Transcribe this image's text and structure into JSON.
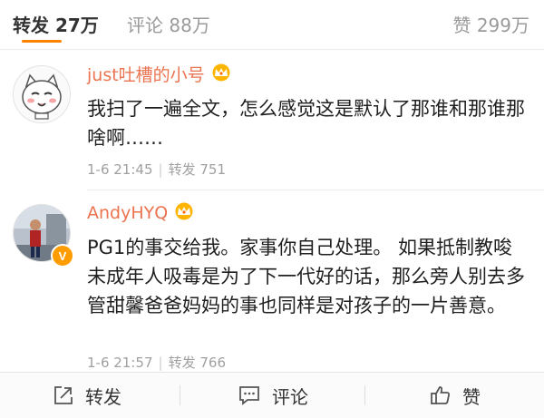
{
  "tabs": {
    "repost": {
      "label": "转发",
      "count": "27万"
    },
    "comment": {
      "label": "评论",
      "count": "88万"
    },
    "like": {
      "label": "赞",
      "count": "299万"
    }
  },
  "comments": [
    {
      "username": "just吐槽的小号",
      "content": "我扫了一遍全文，怎么感觉这是默认了那谁和那谁那啥啊……",
      "time": "1-6 21:45",
      "repost_label": "转发",
      "repost_count": "751"
    },
    {
      "username": "AndyHYQ",
      "content": "PG1的事交给我。家事你自己处理。 如果抵制教唆未成年人吸毒是为了下一代好的话，那么旁人别去多管甜馨爸爸妈妈的事也同样是对孩子的一片善意。",
      "time": "1-6 21:57",
      "repost_label": "转发",
      "repost_count": "766",
      "verified_badge": "V"
    }
  ],
  "actions": {
    "repost": "转发",
    "comment": "评论",
    "like": "赞"
  },
  "colors": {
    "accent": "#ff8200",
    "username": "#eb7350",
    "muted": "#a0a0a0"
  },
  "icons": [
    "crown-icon",
    "repost-icon",
    "comment-icon",
    "thumbs-up-icon"
  ]
}
